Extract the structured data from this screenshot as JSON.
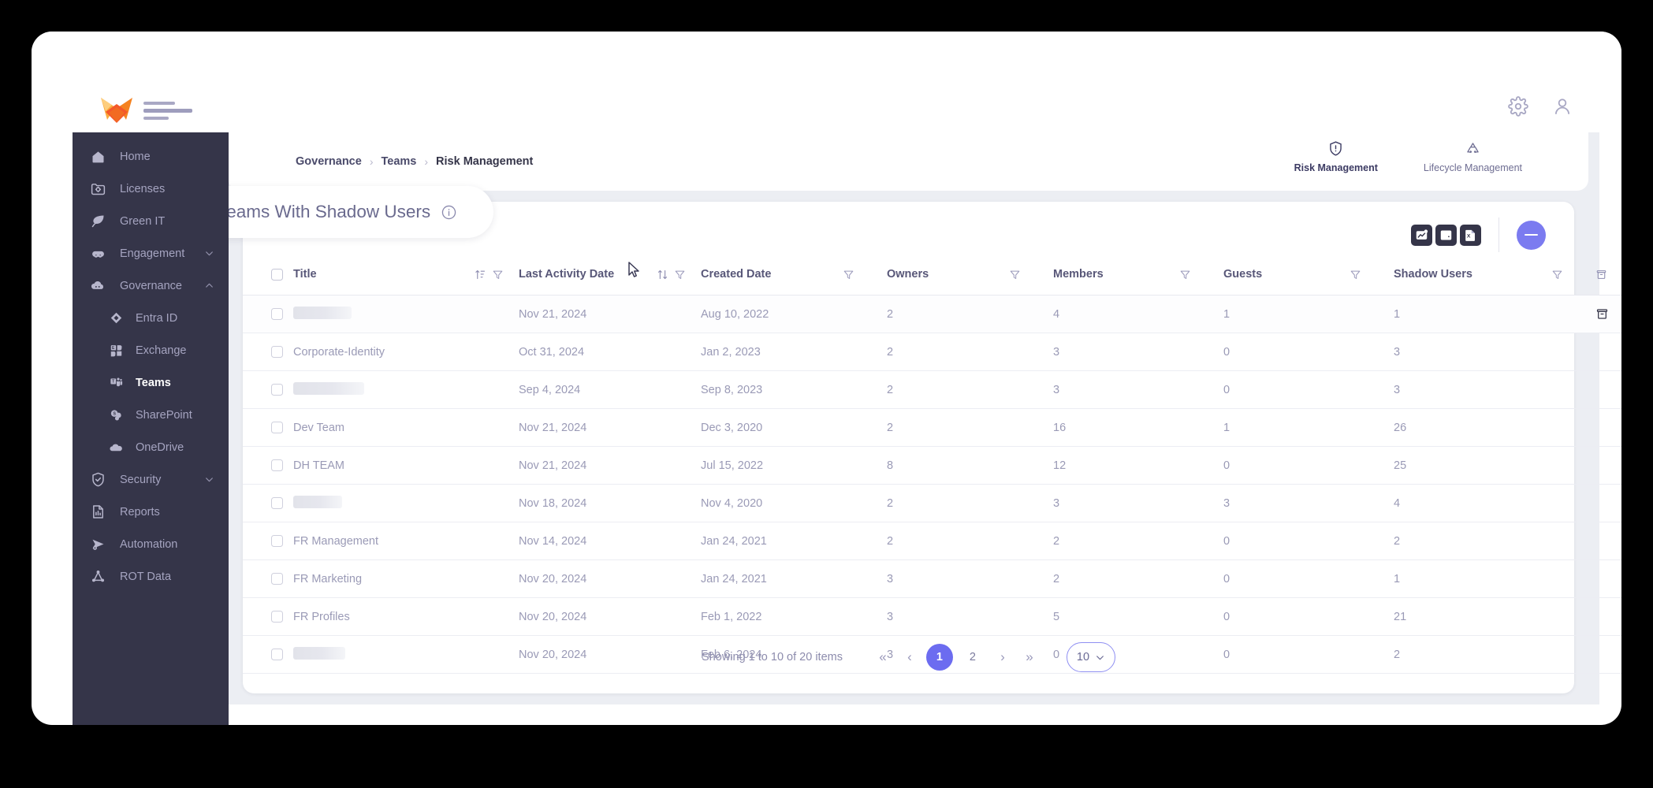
{
  "brand": {
    "logo_name": "fox-logo",
    "accent": "#f26b21",
    "sidebar_bg": "#353549",
    "primary": "#6c6cf0"
  },
  "topbar": {
    "settings_label": "Settings",
    "account_label": "Account"
  },
  "sidebar": {
    "items": [
      {
        "label": "Home",
        "icon": "home-icon",
        "level": 0,
        "active": false,
        "chevron": ""
      },
      {
        "label": "Licenses",
        "icon": "license-icon",
        "level": 0,
        "active": false,
        "chevron": ""
      },
      {
        "label": "Green IT",
        "icon": "leaf-icon",
        "level": 0,
        "active": false,
        "chevron": ""
      },
      {
        "label": "Engagement",
        "icon": "engagement-icon",
        "level": 0,
        "active": false,
        "chevron": "down"
      },
      {
        "label": "Governance",
        "icon": "governance-cloud-icon",
        "level": 0,
        "active": false,
        "chevron": "up"
      },
      {
        "label": "Entra ID",
        "icon": "entra-id-icon",
        "level": 1,
        "active": false,
        "chevron": ""
      },
      {
        "label": "Exchange",
        "icon": "exchange-icon",
        "level": 1,
        "active": false,
        "chevron": ""
      },
      {
        "label": "Teams",
        "icon": "teams-icon",
        "level": 1,
        "active": true,
        "chevron": ""
      },
      {
        "label": "SharePoint",
        "icon": "sharepoint-icon",
        "level": 1,
        "active": false,
        "chevron": ""
      },
      {
        "label": "OneDrive",
        "icon": "onedrive-icon",
        "level": 1,
        "active": false,
        "chevron": ""
      },
      {
        "label": "Security",
        "icon": "shield-check-icon",
        "level": 0,
        "active": false,
        "chevron": "down"
      },
      {
        "label": "Reports",
        "icon": "reports-icon",
        "level": 0,
        "active": false,
        "chevron": ""
      },
      {
        "label": "Automation",
        "icon": "automation-icon",
        "level": 0,
        "active": false,
        "chevron": ""
      },
      {
        "label": "ROT Data",
        "icon": "rot-data-icon",
        "level": 0,
        "active": false,
        "chevron": ""
      }
    ]
  },
  "breadcrumb": {
    "items": [
      "Governance",
      "Teams",
      "Risk Management"
    ],
    "separator": "›"
  },
  "mode_tabs": [
    {
      "label": "Risk Management",
      "icon": "shield-alert-icon",
      "active": true
    },
    {
      "label": "Lifecycle Management",
      "icon": "recycle-icon",
      "active": false
    }
  ],
  "card": {
    "title": "Teams With Shadow Users",
    "info_icon": "info-circle-icon",
    "actions": [
      {
        "name": "insights-chart-button",
        "icon": "chart-trend-icon"
      },
      {
        "name": "alert-settings-button",
        "icon": "bell-gear-icon"
      },
      {
        "name": "export-excel-button",
        "icon": "excel-file-icon"
      }
    ],
    "collapse_button": {
      "name": "collapse-card-button",
      "icon": "minus-circle-icon"
    }
  },
  "table": {
    "columns": [
      {
        "key": "title",
        "label": "Title",
        "sort": "az",
        "filter": true
      },
      {
        "key": "last",
        "label": "Last Activity Date",
        "sort": "updown",
        "filter": true
      },
      {
        "key": "created",
        "label": "Created Date",
        "sort": "",
        "filter": true
      },
      {
        "key": "owners",
        "label": "Owners",
        "sort": "",
        "filter": true
      },
      {
        "key": "members",
        "label": "Members",
        "sort": "",
        "filter": true
      },
      {
        "key": "guests",
        "label": "Guests",
        "sort": "",
        "filter": true
      },
      {
        "key": "shadow",
        "label": "Shadow Users",
        "sort": "",
        "filter": true
      }
    ],
    "archive_column_icon": "archive-icon",
    "rows": [
      {
        "title": "",
        "redacted": true,
        "redact_w": 74,
        "last": "Nov 21, 2024",
        "created": "Aug 10, 2022",
        "owners": "2",
        "members": "4",
        "guests": "1",
        "shadow": "1",
        "hover": true
      },
      {
        "title": "Corporate-Identity",
        "redacted": false,
        "redact_w": 0,
        "last": "Oct 31, 2024",
        "created": "Jan 2, 2023",
        "owners": "2",
        "members": "3",
        "guests": "0",
        "shadow": "3",
        "hover": false
      },
      {
        "title": "",
        "redacted": true,
        "redact_w": 90,
        "last": "Sep 4, 2024",
        "created": "Sep 8, 2023",
        "owners": "2",
        "members": "3",
        "guests": "0",
        "shadow": "3",
        "hover": false
      },
      {
        "title": "Dev Team",
        "redacted": false,
        "redact_w": 0,
        "last": "Nov 21, 2024",
        "created": "Dec 3, 2020",
        "owners": "2",
        "members": "16",
        "guests": "1",
        "shadow": "26",
        "hover": false
      },
      {
        "title": "DH TEAM",
        "redacted": false,
        "redact_w": 0,
        "last": "Nov 21, 2024",
        "created": "Jul 15, 2022",
        "owners": "8",
        "members": "12",
        "guests": "0",
        "shadow": "25",
        "hover": false
      },
      {
        "title": "",
        "redacted": true,
        "redact_w": 62,
        "last": "Nov 18, 2024",
        "created": "Nov 4, 2020",
        "owners": "2",
        "members": "3",
        "guests": "3",
        "shadow": "4",
        "hover": false
      },
      {
        "title": "FR Management",
        "redacted": false,
        "redact_w": 0,
        "last": "Nov 14, 2024",
        "created": "Jan 24, 2021",
        "owners": "2",
        "members": "2",
        "guests": "0",
        "shadow": "2",
        "hover": false
      },
      {
        "title": "FR Marketing",
        "redacted": false,
        "redact_w": 0,
        "last": "Nov 20, 2024",
        "created": "Jan 24, 2021",
        "owners": "3",
        "members": "2",
        "guests": "0",
        "shadow": "1",
        "hover": false
      },
      {
        "title": "FR Profiles",
        "redacted": false,
        "redact_w": 0,
        "last": "Nov 20, 2024",
        "created": "Feb 1, 2022",
        "owners": "3",
        "members": "5",
        "guests": "0",
        "shadow": "21",
        "hover": false
      },
      {
        "title": "",
        "redacted": true,
        "redact_w": 66,
        "last": "Nov 20, 2024",
        "created": "Feb 6, 2024",
        "owners": "3",
        "members": "0",
        "guests": "0",
        "shadow": "2",
        "hover": false
      }
    ]
  },
  "pagination": {
    "showing": "Showing 1 to 10 of 20 items",
    "first_label": "«",
    "prev_label": "‹",
    "pages": [
      "1",
      "2"
    ],
    "active_page": "1",
    "next_label": "›",
    "last_label": "»",
    "page_size": "10"
  }
}
